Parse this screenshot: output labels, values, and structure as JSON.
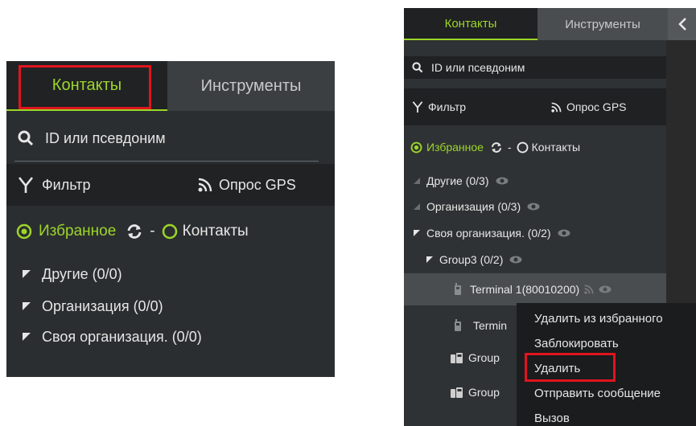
{
  "left": {
    "tabs": {
      "contacts": "Контакты",
      "tools": "Инструменты"
    },
    "search_placeholder": "ID или псевдоним",
    "filter_label": "Фильтр",
    "gps_label": "Опрос GPS",
    "mode": {
      "favorites": "Избранное",
      "separator": "-",
      "contacts": "Контакты"
    },
    "tree": [
      {
        "label": "Другие (0/0)"
      },
      {
        "label": "Организация (0/0)"
      },
      {
        "label": "Своя организация. (0/0)"
      }
    ]
  },
  "right": {
    "tabs": {
      "contacts": "Контакты",
      "tools": "Инструменты"
    },
    "search_placeholder": "ID или псевдоним",
    "filter_label": "Фильтр",
    "gps_label": "Опрос GPS",
    "mode": {
      "favorites": "Избранное",
      "separator": "-",
      "contacts": "Контакты"
    },
    "tree": [
      {
        "label": "Другие (0/3)"
      },
      {
        "label": "Организация (0/3)"
      },
      {
        "label": "Своя организация. (0/2)"
      },
      {
        "label": "Group3 (0/2)"
      },
      {
        "label": "Terminal 1(80010200)"
      },
      {
        "label": "Termin"
      },
      {
        "label": "Group"
      },
      {
        "label": "Group"
      }
    ],
    "context_menu": [
      "Удалить из избранного",
      "Заблокировать",
      "Удалить",
      "Отправить сообщение",
      "Вызов"
    ]
  },
  "colors": {
    "accent": "#9cd629",
    "highlight_box": "#e0141e",
    "panel": "#2b2e30"
  }
}
